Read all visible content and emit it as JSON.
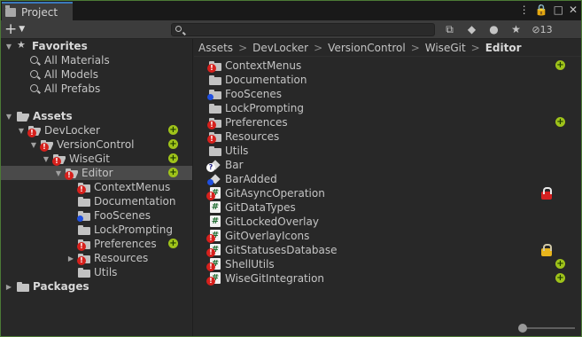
{
  "window": {
    "title": "Project"
  },
  "window_controls": [
    "⋮",
    "🔒",
    "□",
    "✕"
  ],
  "toolbar": {
    "create_label": "+",
    "search_placeholder": "",
    "hidden_count": "13"
  },
  "tree": {
    "favorites_label": "Favorites",
    "favorites": [
      "All Materials",
      "All Models",
      "All Prefabs"
    ],
    "assets_label": "Assets",
    "nodes": [
      {
        "label": "DevLocker",
        "badge": "red",
        "status": "plus"
      },
      {
        "label": "VersionControl",
        "badge": "red",
        "status": "plus"
      },
      {
        "label": "WiseGit",
        "badge": "red",
        "status": "plus"
      },
      {
        "label": "Editor",
        "badge": "red",
        "status": "plus"
      },
      {
        "label": "ContextMenus",
        "badge": "red",
        "status": ""
      },
      {
        "label": "Documentation",
        "badge": "",
        "status": ""
      },
      {
        "label": "FooScenes",
        "badge": "blue",
        "status": ""
      },
      {
        "label": "LockPrompting",
        "badge": "",
        "status": ""
      },
      {
        "label": "Preferences",
        "badge": "red",
        "status": "plus"
      },
      {
        "label": "Resources",
        "badge": "red",
        "status": ""
      },
      {
        "label": "Utils",
        "badge": "",
        "status": ""
      }
    ],
    "packages_label": "Packages"
  },
  "breadcrumb": [
    "Assets",
    "DevLocker",
    "VersionControl",
    "WiseGit",
    "Editor"
  ],
  "items": [
    {
      "label": "ContextMenus",
      "kind": "folder",
      "badge": "red",
      "status": "plus"
    },
    {
      "label": "Documentation",
      "kind": "folder",
      "badge": "",
      "status": ""
    },
    {
      "label": "FooScenes",
      "kind": "folder",
      "badge": "blue",
      "status": ""
    },
    {
      "label": "LockPrompting",
      "kind": "folder",
      "badge": "",
      "status": ""
    },
    {
      "label": "Preferences",
      "kind": "folder",
      "badge": "red",
      "status": "plus"
    },
    {
      "label": "Resources",
      "kind": "folder",
      "badge": "red",
      "status": ""
    },
    {
      "label": "Utils",
      "kind": "folder",
      "badge": "",
      "status": ""
    },
    {
      "label": "Bar",
      "kind": "prefab",
      "badge": "q",
      "status": ""
    },
    {
      "label": "BarAdded",
      "kind": "prefab",
      "badge": "blue",
      "status": ""
    },
    {
      "label": "GitAsyncOperation",
      "kind": "script",
      "badge": "red",
      "status": "lock-red"
    },
    {
      "label": "GitDataTypes",
      "kind": "script",
      "badge": "",
      "status": ""
    },
    {
      "label": "GitLockedOverlay",
      "kind": "script",
      "badge": "",
      "status": ""
    },
    {
      "label": "GitOverlayIcons",
      "kind": "script",
      "badge": "red",
      "status": ""
    },
    {
      "label": "GitStatusesDatabase",
      "kind": "script",
      "badge": "red",
      "status": "lock-yellow"
    },
    {
      "label": "ShellUtils",
      "kind": "script",
      "badge": "red",
      "status": "plus"
    },
    {
      "label": "WiseGitIntegration",
      "kind": "script",
      "badge": "red",
      "status": "plus"
    }
  ],
  "zoom_slider": {
    "value": 0
  },
  "colors": {
    "accent_tab": "#3a79bb",
    "badge_red": "#d6201c",
    "badge_blue": "#1f4fe0",
    "status_plus": "#9fc31a",
    "lock_red": "#d42020",
    "lock_yellow": "#e8b51c"
  }
}
